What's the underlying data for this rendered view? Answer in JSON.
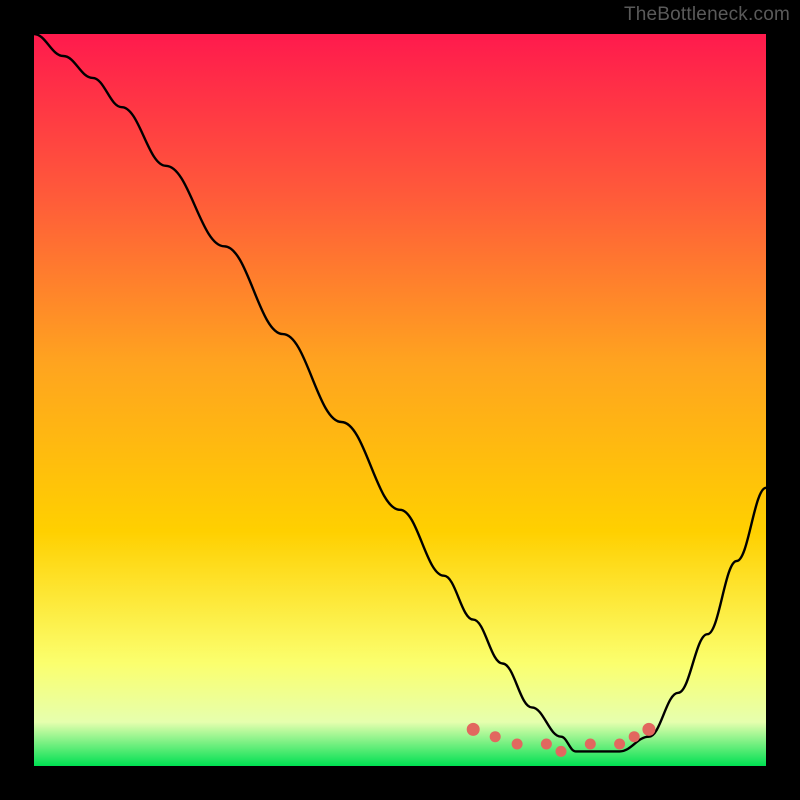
{
  "watermark": "TheBottleneck.com",
  "colors": {
    "gradient_top": "#ff1a4d",
    "gradient_mid_upper": "#ff7a33",
    "gradient_mid": "#ffd000",
    "gradient_low": "#fff56b",
    "gradient_pale": "#f7ffb0",
    "gradient_bottom": "#00e052",
    "curve": "#000000",
    "marker": "#e2675f",
    "marker_fill": "#e2675f"
  },
  "chart_data": {
    "type": "line",
    "title": "",
    "xlabel": "",
    "ylabel": "",
    "xlim": [
      0,
      100
    ],
    "ylim": [
      0,
      100
    ],
    "x": [
      0,
      4,
      8,
      12,
      18,
      26,
      34,
      42,
      50,
      56,
      60,
      64,
      68,
      72,
      74,
      76,
      80,
      84,
      88,
      92,
      96,
      100
    ],
    "values": [
      100,
      97,
      94,
      90,
      82,
      71,
      59,
      47,
      35,
      26,
      20,
      14,
      8,
      4,
      2,
      2,
      2,
      4,
      10,
      18,
      28,
      38
    ],
    "minimum_band": {
      "x_start": 62,
      "x_end": 82,
      "y": 2
    },
    "markers_x": [
      60,
      63,
      66,
      70,
      72,
      76,
      80,
      82,
      84
    ],
    "markers_y": [
      5,
      4,
      3,
      3,
      2,
      3,
      3,
      4,
      5
    ]
  }
}
